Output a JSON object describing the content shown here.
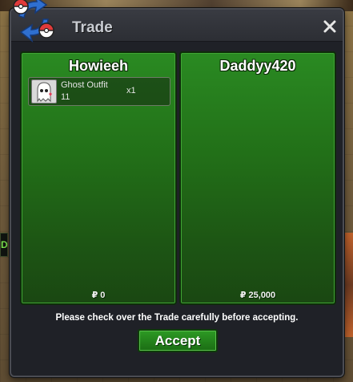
{
  "window": {
    "title": "Trade",
    "notice": "Please check over the Trade carefully before accepting.",
    "accept_label": "Accept"
  },
  "left_player": {
    "name": "Howieeh",
    "money": "₽ 0",
    "items": [
      {
        "name": "Ghost Outfit",
        "qty_line": "11",
        "count": "x1",
        "icon": "ghost-outfit-icon"
      }
    ]
  },
  "right_player": {
    "name": "Daddyy420",
    "money": "₽ 25,000",
    "items": []
  },
  "hud": {
    "left_edge_label": "D"
  },
  "colors": {
    "panel_green": "#227018",
    "accept_green": "#2d9a24",
    "window_bg": "#1f2127",
    "titlebar": "#393b42"
  }
}
